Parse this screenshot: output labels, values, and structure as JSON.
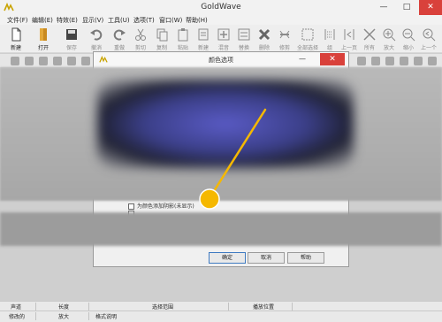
{
  "app": {
    "title": "GoldWave",
    "window_buttons": {
      "minimize": "—",
      "maximize": "□",
      "close": "✕"
    }
  },
  "menu": [
    "文件(F)",
    "编辑(E)",
    "特效(E)",
    "显示(V)",
    "工具(U)",
    "选项(T)",
    "窗口(W)",
    "帮助(H)"
  ],
  "toolbar": [
    {
      "label": "新建",
      "icon": "new-file-icon",
      "enabled": true
    },
    {
      "label": "打开",
      "icon": "open-folder-icon",
      "enabled": true
    },
    {
      "label": "保存",
      "icon": "save-icon",
      "enabled": false
    },
    {
      "label": "撤消",
      "icon": "undo-icon",
      "enabled": false
    },
    {
      "label": "重做",
      "icon": "redo-icon",
      "enabled": false
    },
    {
      "label": "剪切",
      "icon": "cut-icon",
      "enabled": false
    },
    {
      "label": "复制",
      "icon": "copy-icon",
      "enabled": false
    },
    {
      "label": "粘贴",
      "icon": "paste-icon",
      "enabled": false
    },
    {
      "label": "新建",
      "icon": "paste-new-icon",
      "enabled": false
    },
    {
      "label": "混音",
      "icon": "mix-icon",
      "enabled": false
    },
    {
      "label": "替换",
      "icon": "replace-icon",
      "enabled": false
    },
    {
      "label": "删除",
      "icon": "delete-icon",
      "enabled": false
    },
    {
      "label": "修剪",
      "icon": "trim-icon",
      "enabled": false
    },
    {
      "label": "全部选择",
      "icon": "select-all-icon",
      "enabled": false
    },
    {
      "label": "组",
      "icon": "group-icon",
      "enabled": false
    },
    {
      "label": "上一页",
      "icon": "previous-page-icon",
      "enabled": false
    },
    {
      "label": "所有",
      "icon": "zoom-all-icon",
      "enabled": false
    },
    {
      "label": "放大",
      "icon": "zoom-in-icon",
      "enabled": false
    },
    {
      "label": "缩小",
      "icon": "zoom-out-icon",
      "enabled": false
    },
    {
      "label": "上一个",
      "icon": "zoom-previous-icon",
      "enabled": false
    }
  ],
  "dialog": {
    "title": "颜色选项",
    "checkboxes": [
      {
        "label": "为颜色添加阴影(未显示)",
        "checked": false
      },
      {
        "label": "",
        "checked": false
      }
    ],
    "buttons": {
      "ok": "确定",
      "cancel": "取消",
      "help": "帮助"
    }
  },
  "status_bar": {
    "row1": [
      "声道",
      "长度",
      "选择范围",
      "播放位置"
    ],
    "row2": [
      "修改的",
      "放大",
      "格式说明"
    ]
  },
  "colors": {
    "dialog_close": "#d9413b",
    "pointer": "#f5b800",
    "default_button_border": "#3f7bc1"
  }
}
